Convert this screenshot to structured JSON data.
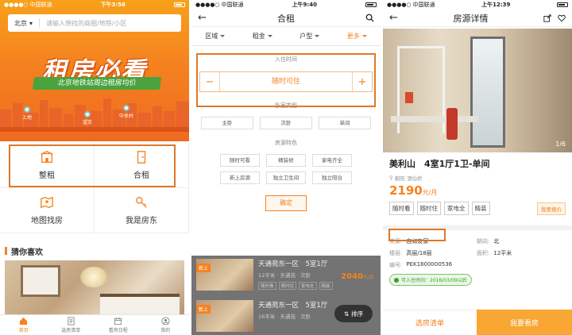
{
  "screen1": {
    "status": {
      "carrier": "中国联通",
      "time": "下午3:56"
    },
    "search": {
      "city": "北京",
      "placeholder": "请输入想找的商圈/地铁/小区"
    },
    "hero": {
      "title": "租房必看",
      "banner": "北京地铁站周边租房均价"
    },
    "pins": [
      "上地",
      "望京",
      "中关村"
    ],
    "tiles": [
      {
        "label": "整租",
        "icon": "building-icon"
      },
      {
        "label": "合租",
        "icon": "door-icon"
      },
      {
        "label": "地图找房",
        "icon": "map-icon"
      },
      {
        "label": "我是房东",
        "icon": "key-icon"
      }
    ],
    "section_title": "猜你喜欢",
    "tabs": [
      {
        "label": "首页",
        "icon": "home-icon"
      },
      {
        "label": "选房清单",
        "icon": "list-icon"
      },
      {
        "label": "看房日程",
        "icon": "calendar-icon"
      },
      {
        "label": "我的",
        "icon": "user-icon"
      }
    ],
    "accent": "#f58220"
  },
  "screen2": {
    "status": {
      "carrier": "中国联通",
      "time": "上午9:40"
    },
    "title": "合租",
    "filters": [
      "区域",
      "租金",
      "户型",
      "更多"
    ],
    "movein_label": "入住时间",
    "movein_value": "随时可住",
    "stepper_minus": "−",
    "stepper_plus": "+",
    "room_label": "卧室类型",
    "rooms": [
      "主卧",
      "次卧",
      "单间"
    ],
    "feature_label": "房源特色",
    "features": [
      "随时可看",
      "精装修",
      "家电齐全",
      "新上房源",
      "独立卫生间",
      "独立阳台"
    ],
    "confirm": "确定",
    "listings": [
      {
        "tag": "新上",
        "title": "天通苑东一区　5室1厅",
        "sub": "12平米 · 天通苑 · 次卧",
        "price": "2040",
        "unit": "元/月",
        "tags": [
          "随时看",
          "随时住",
          "家电全",
          "精装"
        ]
      },
      {
        "tag": "新上",
        "title": "天通苑东一区　5室1厅",
        "sub": "16平米 · 天通苑 · 次卧",
        "price": "",
        "unit": "",
        "tags": []
      }
    ],
    "sort": "排序"
  },
  "screen3": {
    "status": {
      "carrier": "中国联通",
      "time": "上午12:39"
    },
    "title": "房源详情",
    "pager": "1/6",
    "name": "美利山　4室1厅1卫-单间",
    "location": "朝阳 酒仙桥",
    "price": "2190",
    "price_unit": "元/月",
    "tags": [
      "随时看",
      "随时住",
      "家电全",
      "精装"
    ],
    "report": "我要报价",
    "attrs": [
      {
        "k": "来源:",
        "v": "自如友家"
      },
      {
        "k": "朝向:",
        "v": "北"
      },
      {
        "k": "楼层:",
        "v": "高层/18层"
      },
      {
        "k": "面积:",
        "v": "12平米"
      },
      {
        "k": "编号:",
        "v": "PEK1800000536"
      }
    ],
    "available": "可入住时间：2016/03/09以后",
    "btn_list": "选房清单",
    "btn_view": "我要看房"
  }
}
